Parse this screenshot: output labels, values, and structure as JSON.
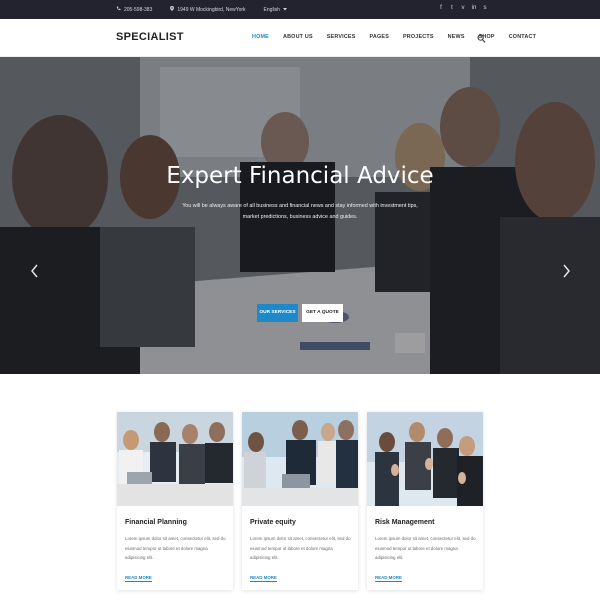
{
  "topbar": {
    "phone": "205-598-383",
    "address": "1949 W Mockingbird, NewYork",
    "language": "English"
  },
  "header": {
    "logo": "SPECIALIST",
    "nav": [
      "HOME",
      "ABOUT US",
      "SERVICES",
      "PAGES",
      "PROJECTS",
      "NEWS",
      "SHOP",
      "CONTACT"
    ],
    "active_nav": "HOME"
  },
  "hero": {
    "title": "Expert Financial Advice",
    "subtitle": "You will be always aware of all business and financial news and stay informed with investment tips, market predictions, business advice and guides.",
    "primary_button": "OUR SERVICES",
    "secondary_button": "GET A QUOTE"
  },
  "cards": [
    {
      "title": "Financial Planning",
      "text": "Lorem ipsum dolor sit amet, consectetur elit, sed do eiusmod tempor ut labore et dolore magna adipisicing elit.",
      "link": "READ MORE"
    },
    {
      "title": "Private equity",
      "text": "Lorem ipsum dolor sit amet, consectetur elit, sed do eiusmod tempor ut labore et dolore magna adipisicing elit.",
      "link": "READ MORE"
    },
    {
      "title": "Risk Management",
      "text": "Lorem ipsum dolor sit amet, consectetur elit, sed do eiusmod tempor ut labore et dolore magna adipisicing elit.",
      "link": "READ MORE"
    }
  ],
  "icons": {
    "phone": "phone-icon",
    "location": "location-pin-icon",
    "language_caret": "caret-down-icon",
    "social": [
      "facebook-icon",
      "twitter-icon",
      "vimeo-icon",
      "linkedin-icon",
      "skype-icon"
    ],
    "search": "search-icon",
    "prev": "chevron-left-icon",
    "next": "chevron-right-icon"
  },
  "colors": {
    "accent": "#1e88c9",
    "topbar": "#23232f"
  }
}
